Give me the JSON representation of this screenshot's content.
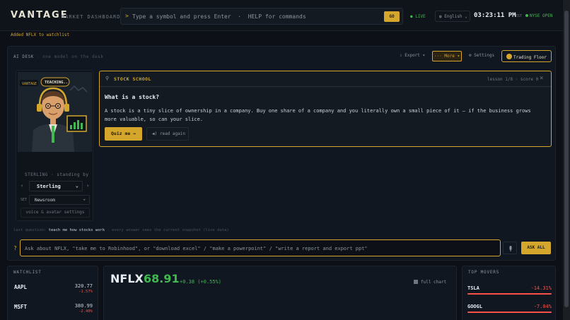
{
  "header": {
    "brand": "VANTAGE",
    "brand_sub": "MARKET DASHBOARD",
    "command_prompt": ">",
    "command_placeholder": "Type a symbol and press Enter  ·  HELP for commands",
    "go_label": "GO",
    "live_label": "● LIVE",
    "language": "English",
    "clock": "03:23:11 PM",
    "timezone": "EST",
    "market_status": "NYSE OPEN"
  },
  "notice": "Added NFLX to watchlist",
  "desk": {
    "title": "AI DESK",
    "subtitle": "· one model on the desk",
    "export_label": "Export ▾",
    "more_label": "··· More ▾",
    "settings_label": "Settings",
    "floor_label": "Trading Floor"
  },
  "avatar": {
    "badge_brand": "VANTAGE",
    "badge_status": "TEACHING..",
    "name_line": "STERLING · standing by",
    "persona": "Sterling",
    "set_label": "SET",
    "set_value": "Newsroom",
    "voice_label": "voice & avatar settings"
  },
  "school": {
    "title": "STOCK SCHOOL",
    "lesson": "lesson 1/8 · score 0",
    "question": "What is a stock?",
    "body": "A stock is a tiny slice of ownership in a company. Buy one share of a company and you literally own a small piece of it — if the business grows more valuable, so can your slice.",
    "quiz_label": "Quiz me →",
    "read_label": "read again"
  },
  "ask": {
    "last_prefix": "last question:",
    "last_question": "teach me how stocks work",
    "last_suffix": "· every answer sees the current snapshot (live data)",
    "mark": "?",
    "placeholder": "Ask about NFLX, \"take me to Robinhood\", or \"download excel\" / \"make a powerpoint\" / \"write a report and export ppt\"",
    "ask_all_label": "ASK ALL"
  },
  "watchlist": {
    "title": "WATCHLIST",
    "items": [
      {
        "symbol": "AAPL",
        "price": "320.77",
        "change": "-1.57%"
      },
      {
        "symbol": "MSFT",
        "price": "380.99",
        "change": "-2.40%"
      }
    ]
  },
  "quote": {
    "symbol": "NFLX",
    "price": "68.91",
    "change": "+0.38 (+0.55%)",
    "full_chart_label": "full chart"
  },
  "movers": {
    "title": "TOP MOVERS",
    "items": [
      {
        "symbol": "TSLA",
        "change": "-14.31%"
      },
      {
        "symbol": "GOOGL",
        "change": "-7.04%"
      }
    ]
  },
  "colors": {
    "accent": "#d4a72c",
    "up": "#3fb950",
    "down": "#f85149",
    "background": "#0d1117"
  }
}
